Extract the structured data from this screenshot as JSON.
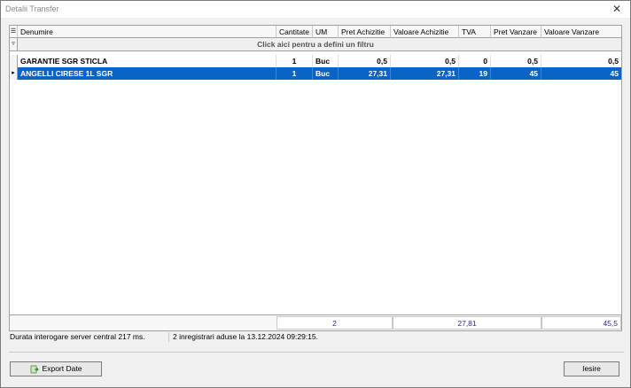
{
  "window": {
    "title": "Detalii Transfer",
    "close_glyph": "✕"
  },
  "grid": {
    "columns": [
      "Denumire",
      "Cantitate",
      "UM",
      "Pret Achizitie",
      "Valoare Achizitie",
      "TVA",
      "Pret Vanzare",
      "Valoare Vanzare"
    ],
    "filter_hint": "Click aici pentru a defini un filtru",
    "rows": [
      {
        "denumire": "GARANTIE SGR STICLA",
        "cantitate": "1",
        "um": "Buc",
        "pret_achizitie": "0,5",
        "valoare_achizitie": "0,5",
        "tva": "0",
        "pret_vanzare": "0,5",
        "valoare_vanzare": "0,5"
      },
      {
        "denumire": "ANGELLI CIRESE 1L SGR",
        "cantitate": "1",
        "um": "Buc",
        "pret_achizitie": "27,31",
        "valoare_achizitie": "27,31",
        "tva": "19",
        "pret_vanzare": "45",
        "valoare_vanzare": "45"
      }
    ],
    "totals": {
      "cantitate": "2",
      "valoare_achizitie": "27,81",
      "valoare_vanzare": "45,5"
    },
    "selected_row": 1,
    "selection_color": "#0a64c8"
  },
  "status": {
    "left": "Durata interogare server central 217 ms.",
    "right": "2 inregistrari aduse la 13.12.2024 09:29:15."
  },
  "buttons": {
    "export_label": "Export Date",
    "exit_label": "Iesire"
  },
  "icons": {
    "close": "close-icon",
    "export": "export-icon",
    "filter": "filter-icon",
    "row_indicator": "row-pointer-icon"
  }
}
